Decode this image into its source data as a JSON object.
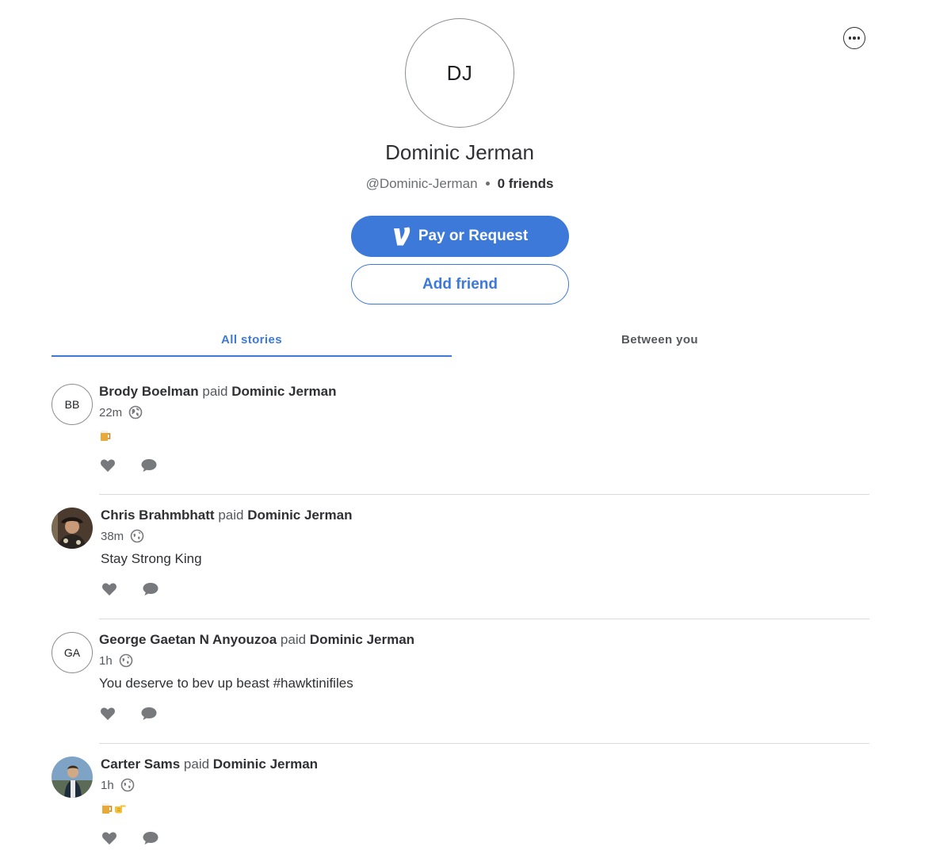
{
  "profile": {
    "initials": "DJ",
    "name": "Dominic Jerman",
    "username": "@Dominic-Jerman",
    "friends_count": "0 friends"
  },
  "actions": {
    "pay_label": "Pay or Request",
    "add_friend_label": "Add friend"
  },
  "tabs": [
    {
      "label": "All stories",
      "active": true
    },
    {
      "label": "Between you",
      "active": false
    }
  ],
  "stories": [
    {
      "avatar_initials": "BB",
      "avatar_type": "initials",
      "payer": "Brody Boelman",
      "verb": "paid",
      "payee": "Dominic Jerman",
      "time": "22m",
      "note": "",
      "note_emoji": [
        "beer-mug"
      ]
    },
    {
      "avatar_initials": "",
      "avatar_type": "photo",
      "payer": "Chris Brahmbhatt",
      "verb": "paid",
      "payee": "Dominic Jerman",
      "time": "38m",
      "note": "Stay Strong King",
      "note_emoji": []
    },
    {
      "avatar_initials": "GA",
      "avatar_type": "initials",
      "payer": "George Gaetan N Anyouzoa",
      "verb": "paid",
      "payee": "Dominic Jerman",
      "time": "1h",
      "note": "You deserve to bev up beast #hawktinifiles",
      "note_emoji": []
    },
    {
      "avatar_initials": "",
      "avatar_type": "photo",
      "payer": "Carter Sams",
      "verb": "paid",
      "payee": "Dominic Jerman",
      "time": "1h",
      "note": "",
      "note_emoji": [
        "beer-mug",
        "pointing-hand"
      ]
    }
  ],
  "colors": {
    "brand_blue": "#3d79d9",
    "text_dark": "#2f3033",
    "text_muted": "#6b6e73",
    "icon_gray": "#77797d"
  }
}
